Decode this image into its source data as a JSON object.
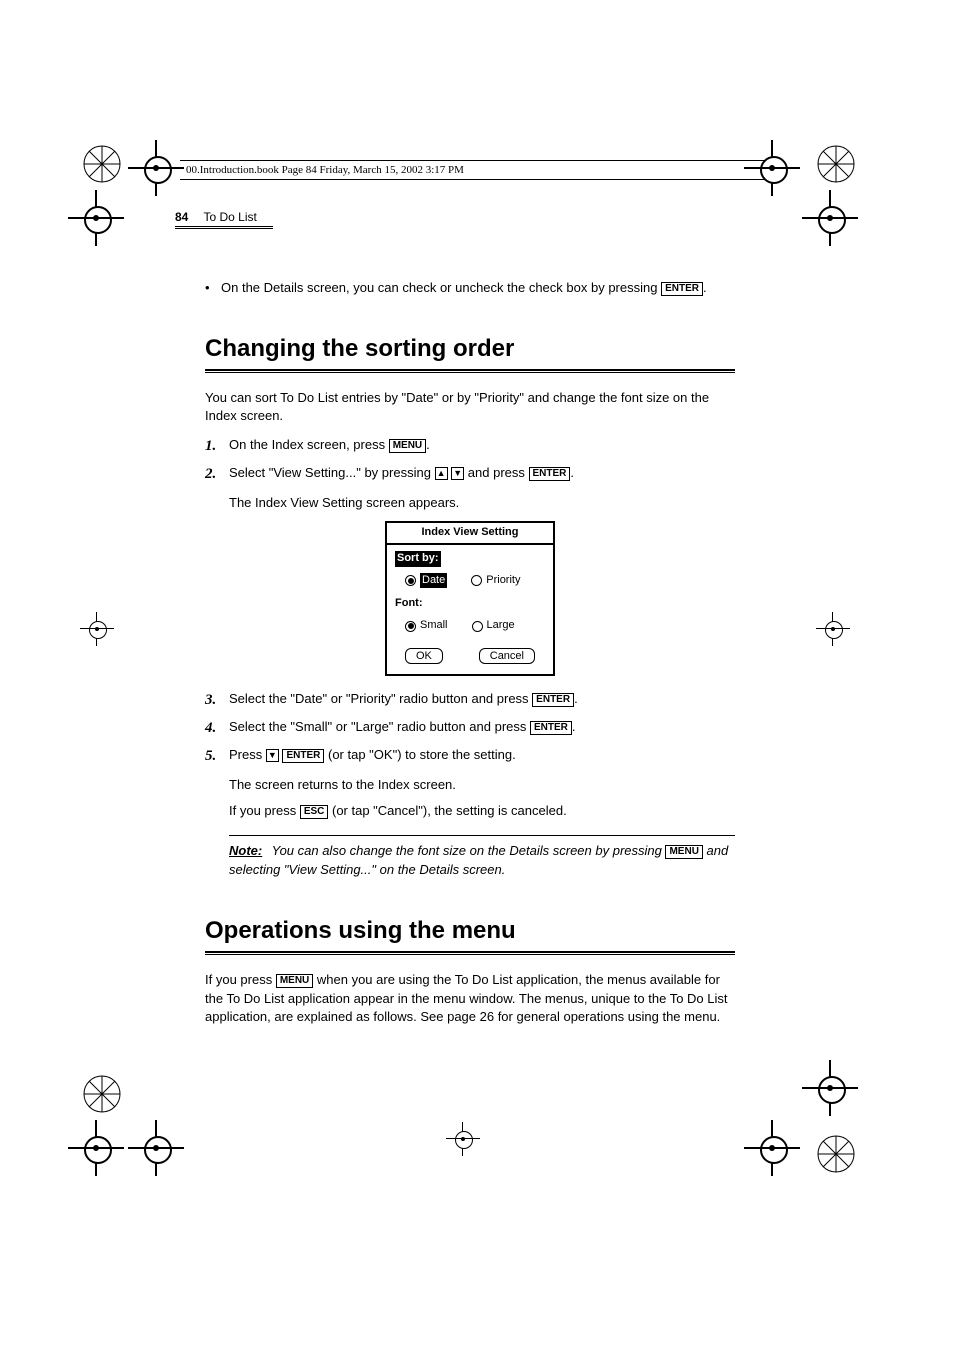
{
  "print_header": "00.Introduction.book  Page 84  Friday, March 15, 2002  3:17 PM",
  "running_head": {
    "page_no": "84",
    "title": "To Do List"
  },
  "intro_bullet": {
    "text_before": "On the Details screen, you can check or uncheck the check box by pressing ",
    "key": "ENTER",
    "text_after": "."
  },
  "section1": {
    "title": "Changing the sorting order",
    "lead": "You can sort To Do List entries by \"Date\" or by \"Priority\" and change the font size on the Index screen.",
    "steps": {
      "s1": {
        "before": "On the Index screen, press ",
        "key": "MENU",
        "after": "."
      },
      "s2": {
        "before": "Select \"View Setting...\" by pressing ",
        "mid": " and press ",
        "key": "ENTER",
        "after": ".",
        "sub": "The Index View Setting screen appears."
      },
      "s3": {
        "before": "Select the \"Date\" or \"Priority\" radio button and press ",
        "key": "ENTER",
        "after": "."
      },
      "s4": {
        "before": "Select the \"Small\" or \"Large\" radio button and press ",
        "key": "ENTER",
        "after": "."
      },
      "s5": {
        "before": "Press ",
        "mid": " (or tap \"OK\") to store the setting.",
        "key": "ENTER",
        "sub1": "The screen returns to the Index screen.",
        "sub2a": "If you press ",
        "sub2key": "ESC",
        "sub2b": " (or tap \"Cancel\"), the setting is canceled."
      }
    },
    "dialog": {
      "title": "Index View Setting",
      "group1_label": "Sort by:",
      "opt1a": "Date",
      "opt1b": "Priority",
      "group2_label": "Font:",
      "opt2a": "Small",
      "opt2b": "Large",
      "ok": "OK",
      "cancel": "Cancel"
    },
    "note": {
      "label": "Note:",
      "t1": "You can also change the font size on the Details screen by pressing ",
      "key": "MENU",
      "t2": " and selecting \"View Setting...\" on the Details screen."
    }
  },
  "section2": {
    "title": "Operations using the menu",
    "p_before": "If you press ",
    "key": "MENU",
    "p_after": " when you are using the To Do List application, the menus available for the To Do List application appear in the menu window. The menus, unique to the To Do List application, are explained as follows. See page 26 for general operations using the menu."
  }
}
